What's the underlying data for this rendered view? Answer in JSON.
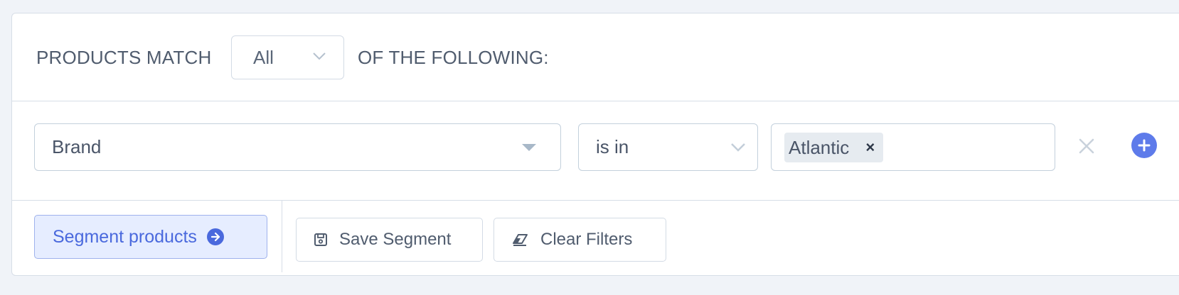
{
  "match_row": {
    "prefix": "PRODUCTS MATCH",
    "selected": "All",
    "suffix": "OF THE FOLLOWING:"
  },
  "filter": {
    "field": "Brand",
    "operator": "is in",
    "values": [
      "Atlantic"
    ],
    "tag_remove_glyph": "×"
  },
  "actions": {
    "segment_label": "Segment products",
    "save_label": "Save Segment",
    "clear_label": "Clear Filters"
  },
  "icons": {
    "match_dropdown": "chevron-down-icon",
    "field_dropdown": "caret-down-icon",
    "operator_dropdown": "chevron-down-icon",
    "remove_filter": "close-icon",
    "add_filter": "plus-circle-icon",
    "segment_go": "arrow-right-circle-icon",
    "save": "floppy-disk-icon",
    "clear": "eraser-icon"
  },
  "colors": {
    "accent": "#5e7bea",
    "primary_text": "#4a69dd",
    "background": "#f0f3f8",
    "border": "#d7dee7"
  }
}
